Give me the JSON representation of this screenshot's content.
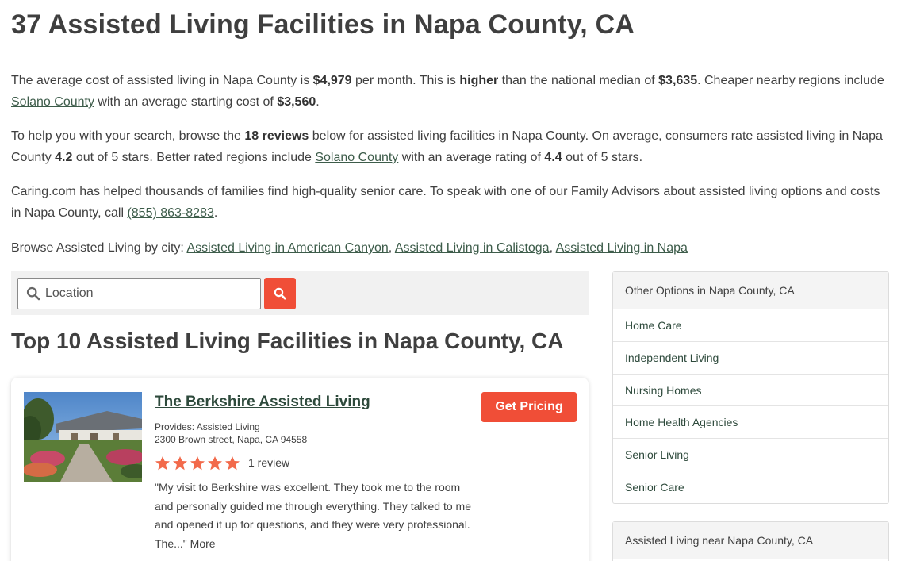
{
  "page": {
    "title": "37 Assisted Living Facilities in Napa County, CA"
  },
  "intro": {
    "p1": {
      "t1": "The average cost of assisted living in Napa County is ",
      "avg_cost": "$4,979",
      "t2": " per month. This is ",
      "comparison": "higher",
      "t3": " than the national median of ",
      "national_median": "$3,635",
      "t4": ". Cheaper nearby regions include ",
      "cheaper_region_link": "Solano County",
      "t5": " with an average starting cost of ",
      "cheaper_cost": "$3,560",
      "t6": "."
    },
    "p2": {
      "t1": "To help you with your search, browse the ",
      "reviews_count": "18 reviews",
      "t2": " below for assisted living facilities in Napa County. On average, consumers rate assisted living in Napa County ",
      "rating": "4.2",
      "t3": " out of 5 stars. Better rated regions include ",
      "better_region_link": "Solano County",
      "t4": " with an average rating of ",
      "better_rating": "4.4",
      "t5": " out of 5 stars."
    },
    "p3": {
      "t1": "Caring.com has helped thousands of families find high-quality senior care. To speak with one of our Family Advisors about assisted living options and costs in Napa County, call ",
      "phone": "(855) 863-8283",
      "t2": "."
    },
    "p4": {
      "label": "Browse Assisted Living by city: ",
      "cities": [
        "Assisted Living in American Canyon",
        "Assisted Living in Calistoga",
        "Assisted Living in Napa"
      ],
      "sep": ", "
    }
  },
  "search": {
    "placeholder": "Location",
    "icon": "search-icon"
  },
  "listing": {
    "heading": "Top 10 Assisted Living Facilities in Napa County, CA",
    "card": {
      "name": "The Berkshire Assisted Living",
      "provides": "Provides: Assisted Living",
      "address": "2300 Brown street, Napa, CA 94558",
      "stars": 5,
      "review_count": "1 review",
      "quote": "\"My visit to Berkshire was excellent. They took me to the room and personally guided me through everything. They talked to me and opened it up for questions, and they were very professional. The...\"",
      "more": "More",
      "cta": "Get Pricing"
    }
  },
  "sidebar": {
    "box1": {
      "title": "Other Options in Napa County, CA",
      "items": [
        "Home Care",
        "Independent Living",
        "Nursing Homes",
        "Home Health Agencies",
        "Senior Living",
        "Senior Care"
      ]
    },
    "box2": {
      "title": "Assisted Living near Napa County, CA"
    }
  },
  "colors": {
    "accent": "#f04e37",
    "star": "#f26a4b",
    "link": "#3d5c4a"
  }
}
